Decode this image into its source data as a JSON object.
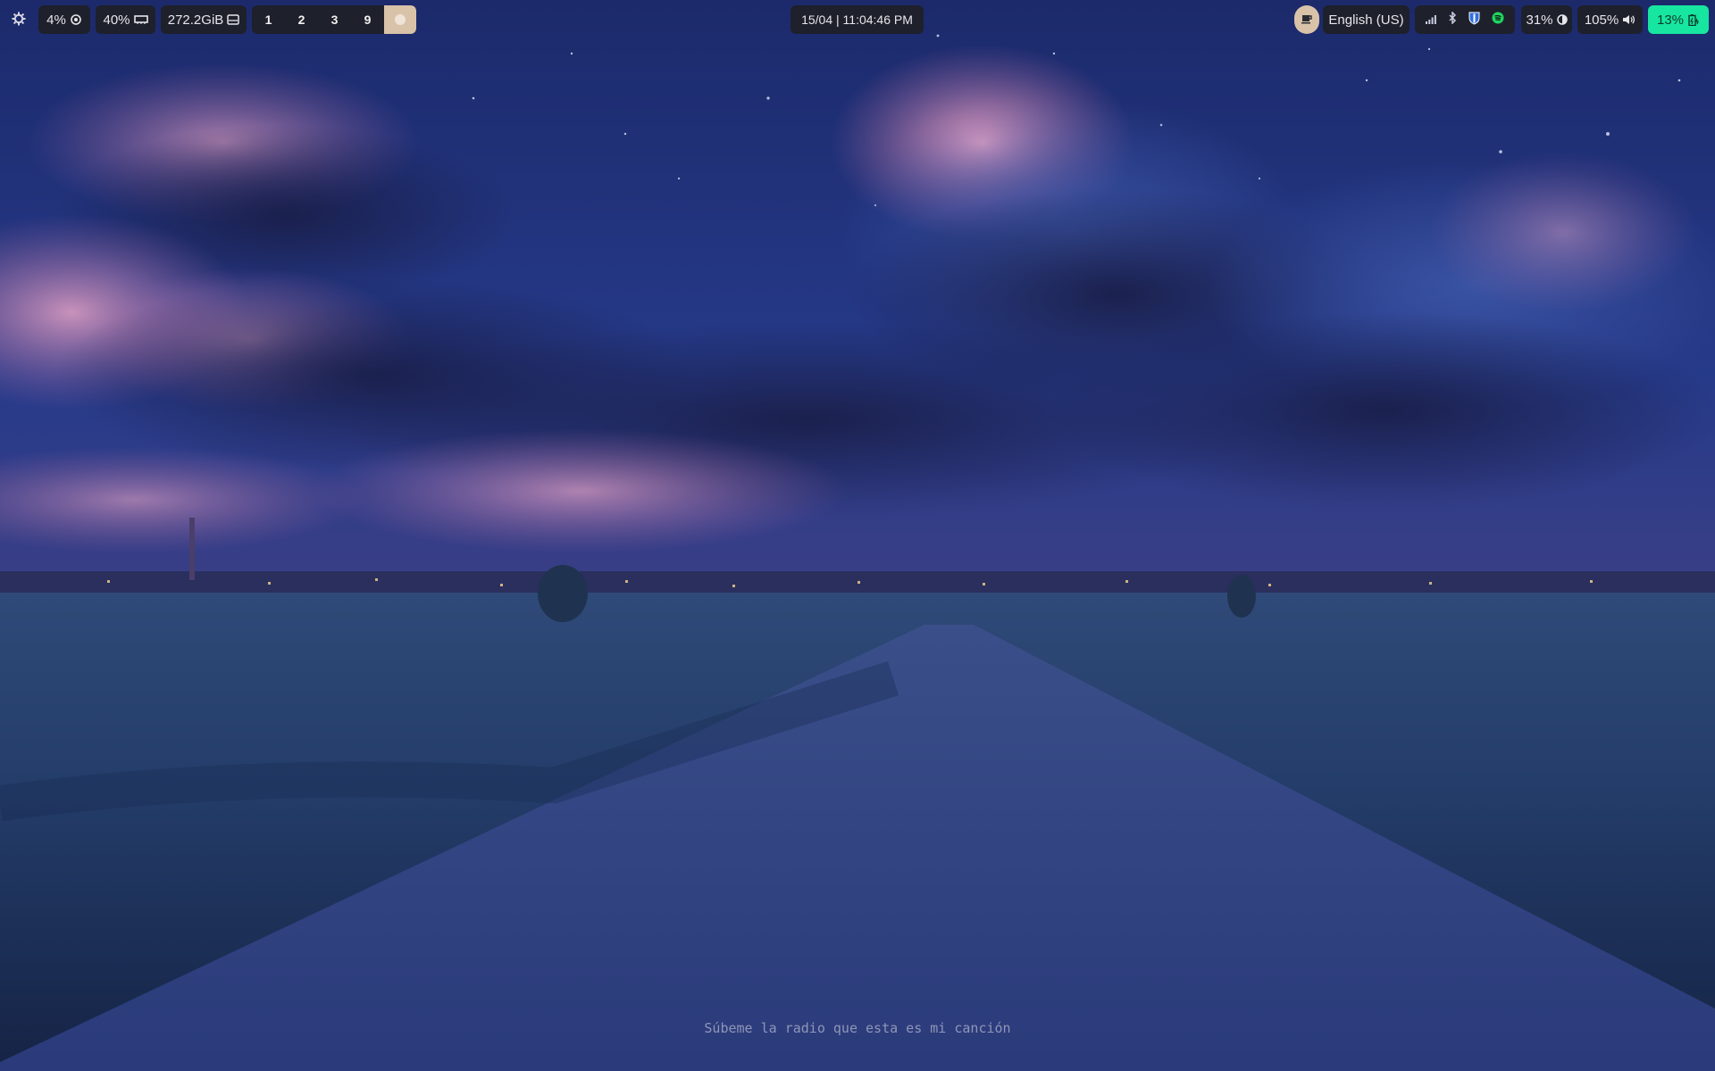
{
  "topbar": {
    "launcher_icon": "gear-icon",
    "cpu": {
      "value": "4%",
      "icon": "cpu-icon"
    },
    "memory": {
      "value": "40%",
      "icon": "memory-icon"
    },
    "disk": {
      "value": "272.2GiB",
      "icon": "disk-icon"
    },
    "workspaces": [
      {
        "label": "1"
      },
      {
        "label": "2"
      },
      {
        "label": "3"
      },
      {
        "label": "9"
      }
    ],
    "clock": "15/04 | 11:04:46 PM",
    "tray_icons": [
      "coffee-icon",
      "signal-icon",
      "bluetooth-icon",
      "shield-icon",
      "spotify-icon"
    ],
    "keyboard_layout": "English (US)",
    "brightness": {
      "value": "31%",
      "icon": "brightness-icon"
    },
    "volume": {
      "value": "105%",
      "icon": "volume-icon"
    },
    "battery": {
      "value": "13%",
      "icon": "battery-charging-icon"
    }
  },
  "desktop": {
    "now_playing": "Súbeme la radio que esta es mi canción"
  },
  "colors": {
    "bar_module_bg": "#1e1f26",
    "battery_accent": "#17e6a0",
    "active_workspace": "#d9c3a8",
    "sky_top": "#1d2a6e",
    "cloud_pink": "#d98bb0"
  }
}
